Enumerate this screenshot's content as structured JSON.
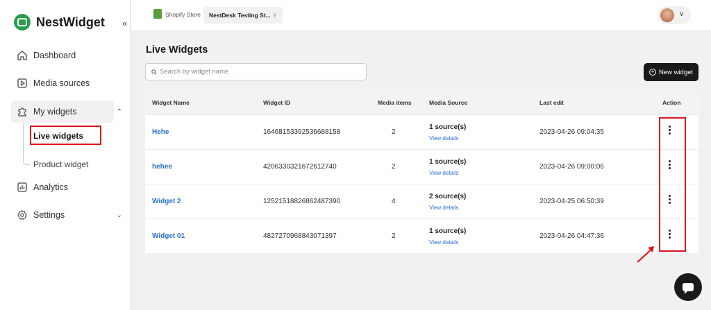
{
  "sidebar": {
    "brand": "NestWidget",
    "collapse_icon": "«",
    "items": [
      {
        "label": "Dashboard",
        "icon": "home-icon"
      },
      {
        "label": "Media sources",
        "icon": "play-icon"
      },
      {
        "label": "My widgets",
        "icon": "puzzle-icon"
      },
      {
        "label": "Analytics",
        "icon": "chart-icon"
      },
      {
        "label": "Settings",
        "icon": "gear-icon"
      }
    ],
    "sub_items": [
      {
        "label": "Live widgets"
      },
      {
        "label": "Product widget"
      }
    ]
  },
  "topbar": {
    "shop_label": "Shopify Store",
    "store_name": "NestDesk Testing St..."
  },
  "main": {
    "title": "Live Widgets",
    "search_placeholder": "Search by widget name",
    "new_button": "New widget",
    "columns": [
      "Widget Name",
      "Widget ID",
      "Media items",
      "Media Source",
      "Last edit",
      "Action"
    ],
    "rows": [
      {
        "name": "Hehe",
        "id": "16468153392536688158",
        "media": "2",
        "source": "1 source(s)",
        "view": "View details",
        "edit": "2023-04-26 09:04:35"
      },
      {
        "name": "hehee",
        "id": "4206330321672612740",
        "media": "2",
        "source": "1 source(s)",
        "view": "View details",
        "edit": "2023-04-26 09:00:06"
      },
      {
        "name": "Widget 2",
        "id": "12521518826862487390",
        "media": "4",
        "source": "2 source(s)",
        "view": "View details",
        "edit": "2023-04-25 06:50:39"
      },
      {
        "name": "Widget 01",
        "id": "4827270968843071397",
        "media": "2",
        "source": "1 source(s)",
        "view": "View details",
        "edit": "2023-04-26 04:47:36"
      }
    ]
  },
  "colors": {
    "brand_green": "#2a9d4b",
    "link_blue": "#2a71d0",
    "highlight_red": "#e0111b"
  }
}
